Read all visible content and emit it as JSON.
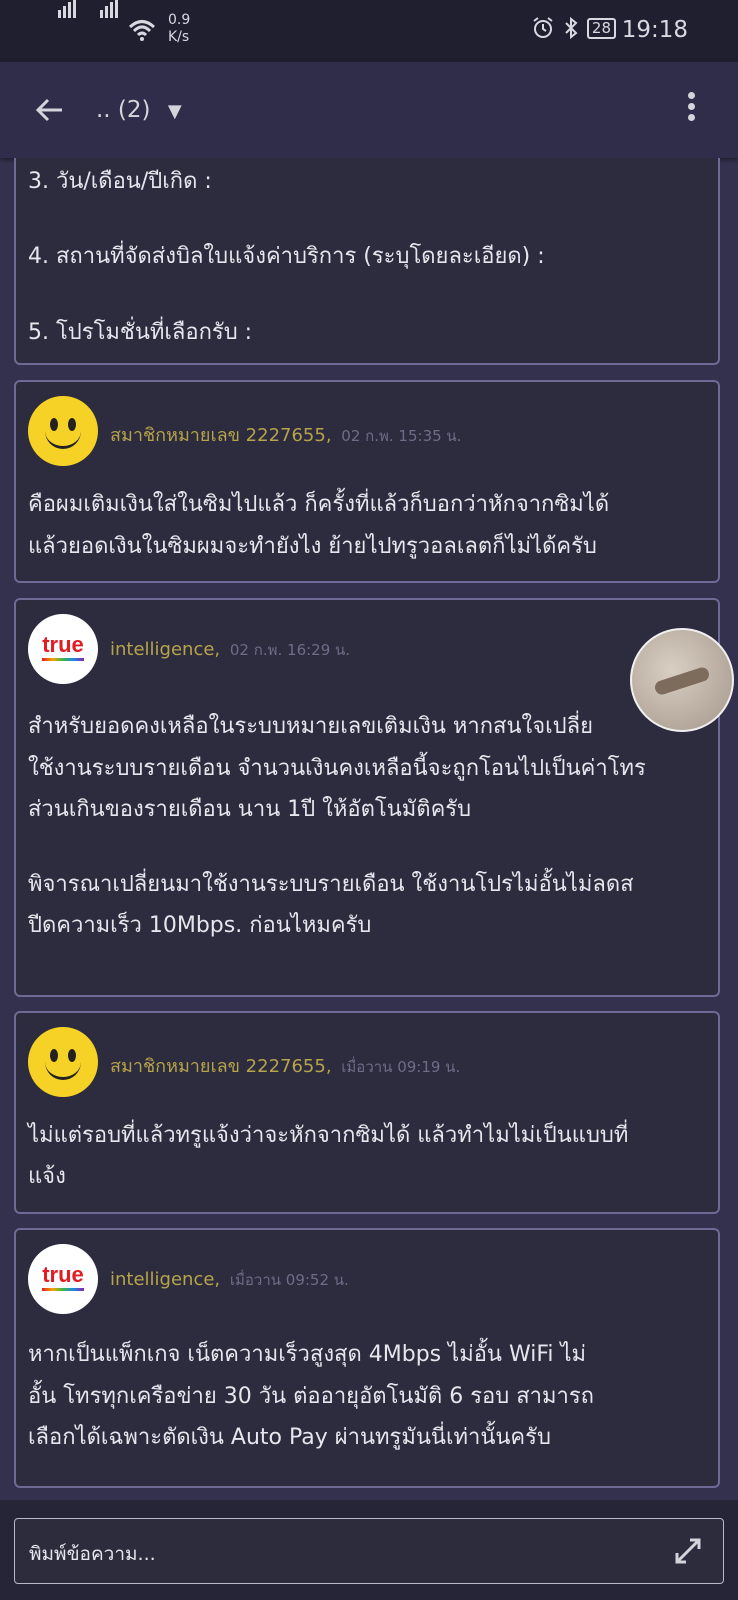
{
  "status_bar": {
    "net_speed_value": "0.9",
    "net_speed_unit": "K/s",
    "battery": "28",
    "time": "19:18"
  },
  "toolbar": {
    "title": ".. (2)",
    "dropdown_arrow": "▼"
  },
  "form_card": {
    "lines": [
      "3. วัน/เดือน/ปีเกิด :",
      "4. สถานที่จัดส่งบิลใบแจ้งค่าบริการ (ระบุโดยละเอียด) :",
      "5. โปรโมชั่นที่เลือกรับ :"
    ]
  },
  "messages": [
    {
      "author": "สมาชิกหมายเลข 2227655,",
      "time": "02 ก.พ. 15:35 น.",
      "avatar": "smiley-icon",
      "lines": [
        "คือผมเติมเงินใส่ในซิมไปแล้ว ก็ครั้งที่แล้วก็บอกว่าหักจากซิมได้",
        "แล้วยอดเงินในซิมผมจะทำยังไง ย้ายไปทรูวอลเลตก็ไม่ได้ครับ"
      ]
    },
    {
      "author": "intelligence,",
      "time": "02 ก.พ. 16:29 น.",
      "avatar": "true-logo",
      "logo_text": "true",
      "lines": [
        "สำหรับยอดคงเหลือในระบบหมายเลขเติมเงิน หากสนใจเปลี่ย",
        "ใช้งานระบบรายเดือน จำนวนเงินคงเหลือนี้จะถูกโอนไปเป็นค่าโทร",
        "ส่วนเกินของรายเดือน นาน 1ปี ให้อัตโนมัติครับ",
        "พิจารณาเปลี่ยนมาใช้งานระบบรายเดือน ใช้งานโปรไม่อั้นไม่ลดส",
        "ปีดความเร็ว 10Mbps. ก่อนไหมครับ"
      ]
    },
    {
      "author": "สมาชิกหมายเลข 2227655,",
      "time": "เมื่อวาน 09:19 น.",
      "avatar": "smiley-icon",
      "lines": [
        "ไม่แต่รอบที่แล้วทรูแจ้งว่าจะหักจากซิมได้ แล้วทำไมไม่เป็นแบบที่",
        "แจ้ง"
      ]
    },
    {
      "author": "intelligence,",
      "time": "เมื่อวาน 09:52 น.",
      "avatar": "true-logo",
      "logo_text": "true",
      "lines": [
        "หากเป็นแพ็กเกจ เน็ตความเร็วสูงสุด 4Mbps ไม่อั้น  WiFi ไม่",
        "อั้น  โทรทุกเครือข่าย 30 วัน ต่ออายุอัตโนมัติ 6 รอบ สามารถ",
        "เลือกได้เฉพาะตัดเงิน Auto Pay ผ่านทรูมันนี่เท่านั้นครับ"
      ]
    }
  ],
  "composer": {
    "placeholder": "พิมพ์ข้อความ..."
  },
  "colors": {
    "background": "#33314d",
    "card": "#2d2b3e",
    "card_border": "#6d6b96",
    "author_name": "#b5a44a",
    "timestamp": "#6e6c88"
  }
}
